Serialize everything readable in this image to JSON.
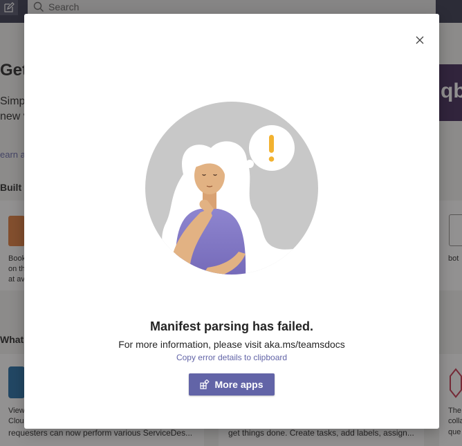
{
  "background": {
    "search_placeholder": "Search",
    "heading_fragment": "Get",
    "intro_line1": "Simp",
    "intro_line2": "new v",
    "learn_link": "earn a",
    "built_for": "Built fo",
    "card_left_text": [
      "Book",
      "on th",
      "at av"
    ],
    "card_right_text": "bot",
    "whats_new": "What's",
    "card_bottom_left_text": [
      "View",
      "Clou",
      "requesters can now perform various ServiceDes..."
    ],
    "card_bottom_mid_text": "get things done. Create tasks, add labels, assign...",
    "card_bottom_right_text": [
      "The",
      "colla",
      "que"
    ],
    "app_logo_text": "qb"
  },
  "dialog": {
    "title": "Manifest parsing has failed.",
    "subtitle": "For more information, please visit aka.ms/teamsdocs",
    "copy_link": "Copy error details to clipboard",
    "primary_button": "More apps",
    "icons": {
      "close": "close-icon",
      "apps": "apps-icon"
    }
  },
  "colors": {
    "accent": "#6264a7",
    "topbar": "#33344a",
    "alert": "#f2b230"
  }
}
